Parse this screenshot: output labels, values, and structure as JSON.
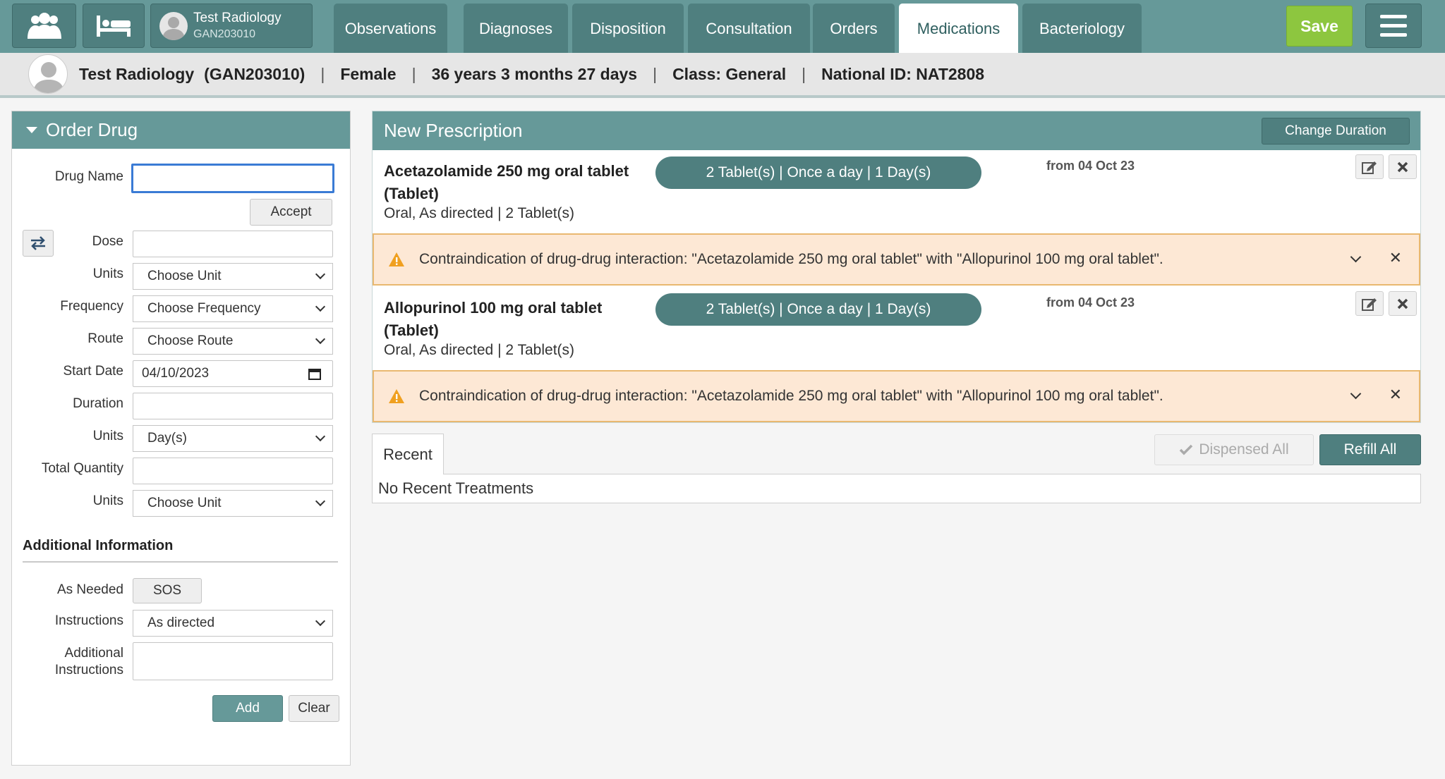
{
  "header": {
    "patient_name": "Test Radiology",
    "patient_id": "GAN203010",
    "tabs": [
      {
        "label": "Observations",
        "active": false
      },
      {
        "label": "Diagnoses",
        "active": false
      },
      {
        "label": "Disposition",
        "active": false
      },
      {
        "label": "Consultation",
        "active": false
      },
      {
        "label": "Orders",
        "active": false
      },
      {
        "label": "Medications",
        "active": true
      },
      {
        "label": "Bacteriology",
        "active": false
      }
    ],
    "save_label": "Save",
    "icons": {
      "patients": "patients-icon",
      "bed": "bed-icon",
      "menu": "hamburger-menu-icon"
    },
    "colors": {
      "header_bg": "#669999",
      "save_bg": "#8dc63f"
    }
  },
  "infobar": {
    "name": "Test Radiology",
    "id": "(GAN203010)",
    "gender": "Female",
    "age": "36 years 3 months 27 days",
    "class": "Class: General",
    "national_id": "National ID: NAT2808"
  },
  "order_drug": {
    "title": "Order Drug",
    "fields": {
      "drug_name": {
        "label": "Drug Name",
        "value": ""
      },
      "accept": "Accept",
      "dose": {
        "label": "Dose",
        "value": ""
      },
      "dose_units": {
        "label": "Units",
        "value": "Choose Unit"
      },
      "frequency": {
        "label": "Frequency",
        "value": "Choose Frequency"
      },
      "route": {
        "label": "Route",
        "value": "Choose Route"
      },
      "start_date": {
        "label": "Start Date",
        "value": "04/10/2023"
      },
      "duration": {
        "label": "Duration",
        "value": ""
      },
      "duration_units": {
        "label": "Units",
        "value": "Day(s)"
      },
      "total_quantity": {
        "label": "Total Quantity",
        "value": ""
      },
      "quantity_units": {
        "label": "Units",
        "value": "Choose Unit"
      }
    },
    "additional": {
      "title": "Additional Information",
      "as_needed_label": "As Needed",
      "sos_label": "SOS",
      "instructions_label": "Instructions",
      "instructions_value": "As directed",
      "additional_instructions_label_1": "Additional",
      "additional_instructions_label_2": "Instructions",
      "additional_instructions_value": ""
    },
    "add_label": "Add",
    "clear_label": "Clear"
  },
  "prescription": {
    "title": "New Prescription",
    "change_duration": "Change Duration",
    "drugs": [
      {
        "name_line1": "Acetazolamide 250 mg oral tablet",
        "name_line2": "(Tablet)",
        "summary": "2 Tablet(s) | Once a day | 1 Day(s)",
        "route": "Oral, As directed  |  2 Tablet(s)",
        "from": "from 04 Oct 23",
        "alert": "Contraindication of drug-drug interaction: \"Acetazolamide 250 mg oral tablet\" with \"Allopurinol 100 mg oral tablet\"."
      },
      {
        "name_line1": "Allopurinol 100 mg oral tablet",
        "name_line2": "(Tablet)",
        "summary": "2 Tablet(s) | Once a day | 1 Day(s)",
        "route": "Oral, As directed  |  2 Tablet(s)",
        "from": "from 04 Oct 23",
        "alert": "Contraindication of drug-drug interaction: \"Acetazolamide 250 mg oral tablet\" with \"Allopurinol 100 mg oral tablet\"."
      }
    ]
  },
  "recent": {
    "tab_label": "Recent",
    "dispensed_all": "Dispensed All",
    "refill_all": "Refill All",
    "empty_text": "No Recent Treatments"
  }
}
